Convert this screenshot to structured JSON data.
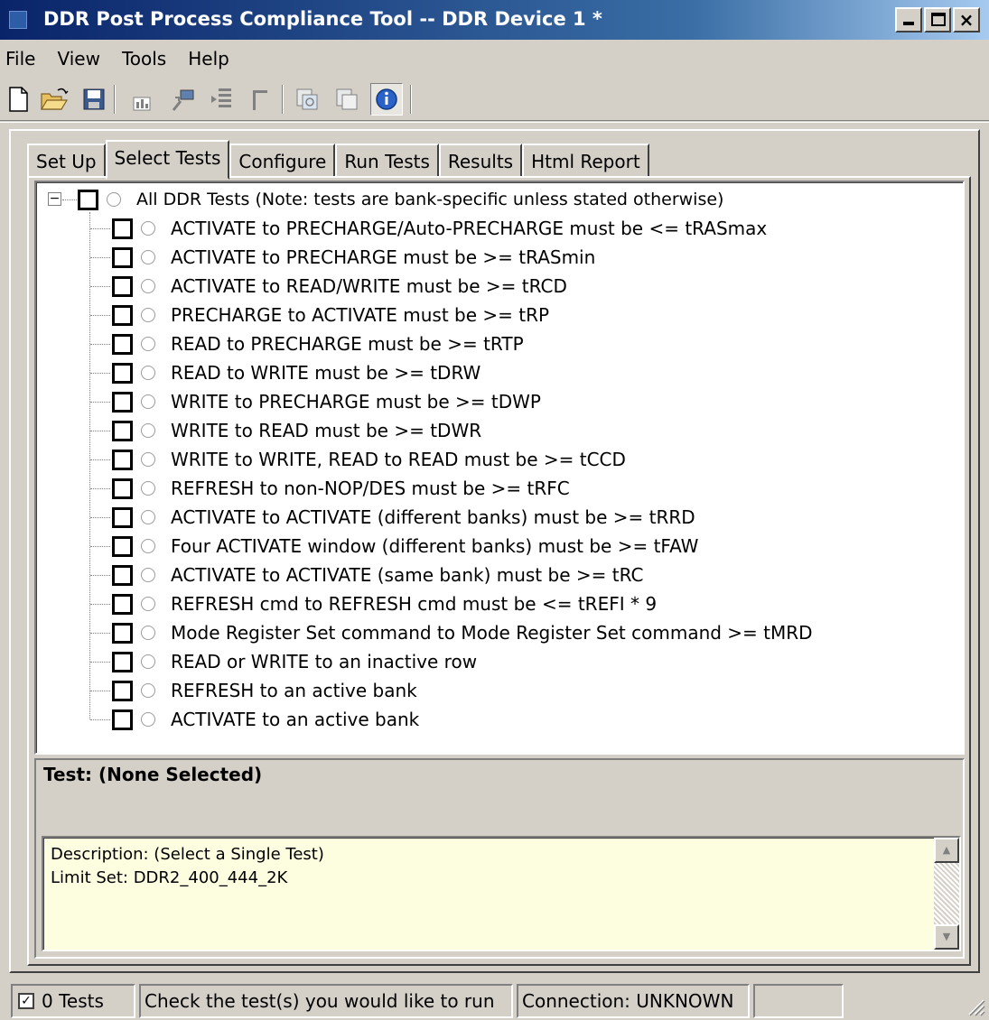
{
  "window": {
    "title": "DDR Post Process Compliance Tool -- DDR Device 1 *",
    "controls": {
      "close": "×"
    }
  },
  "menu": [
    "File",
    "View",
    "Tools",
    "Help"
  ],
  "toolbar": {
    "icons": [
      "new-file-icon",
      "open-folder-icon",
      "save-icon",
      "bar-chart-icon",
      "export-chart-icon",
      "table-list-icon",
      "bracket-icon",
      "copy-icon",
      "duplicate-icon",
      "info-icon"
    ]
  },
  "tabs": [
    "Set Up",
    "Select Tests",
    "Configure",
    "Run Tests",
    "Results",
    "Html Report"
  ],
  "active_tab": "Select Tests",
  "tree": {
    "expander": "−",
    "root": "All DDR Tests (Note: tests are bank-specific unless stated otherwise)",
    "items": [
      "ACTIVATE to PRECHARGE/Auto-PRECHARGE must be <= tRASmax",
      "ACTIVATE to PRECHARGE must be >= tRASmin",
      "ACTIVATE to READ/WRITE must be >= tRCD",
      "PRECHARGE to ACTIVATE must be >= tRP",
      "READ to PRECHARGE must be >= tRTP",
      "READ to WRITE must be >= tDRW",
      "WRITE to PRECHARGE must be >= tDWP",
      "WRITE to READ must be >= tDWR",
      "WRITE to WRITE, READ to READ must be >= tCCD",
      "REFRESH to non-NOP/DES must be >= tRFC",
      "ACTIVATE to ACTIVATE (different banks) must be >= tRRD",
      "Four ACTIVATE window (different banks) must be >= tFAW",
      "ACTIVATE to ACTIVATE (same bank) must be >= tRC",
      "REFRESH cmd to REFRESH cmd must be <= tREFI * 9",
      "Mode Register Set command to Mode Register Set command >= tMRD",
      "READ or WRITE to an inactive row",
      "REFRESH to an active bank",
      "ACTIVATE to an active bank"
    ]
  },
  "details": {
    "test_title": "Test: (None Selected)",
    "description": "Description: (Select a Single Test)",
    "limit_set": "Limit Set: DDR2_400_444_2K",
    "scroll_up": "▲",
    "scroll_down": "▼"
  },
  "status": {
    "check": "✓",
    "tests_count": "0 Tests",
    "message": "Check the test(s) you would like to run",
    "connection": "Connection: UNKNOWN",
    "extra": ""
  }
}
